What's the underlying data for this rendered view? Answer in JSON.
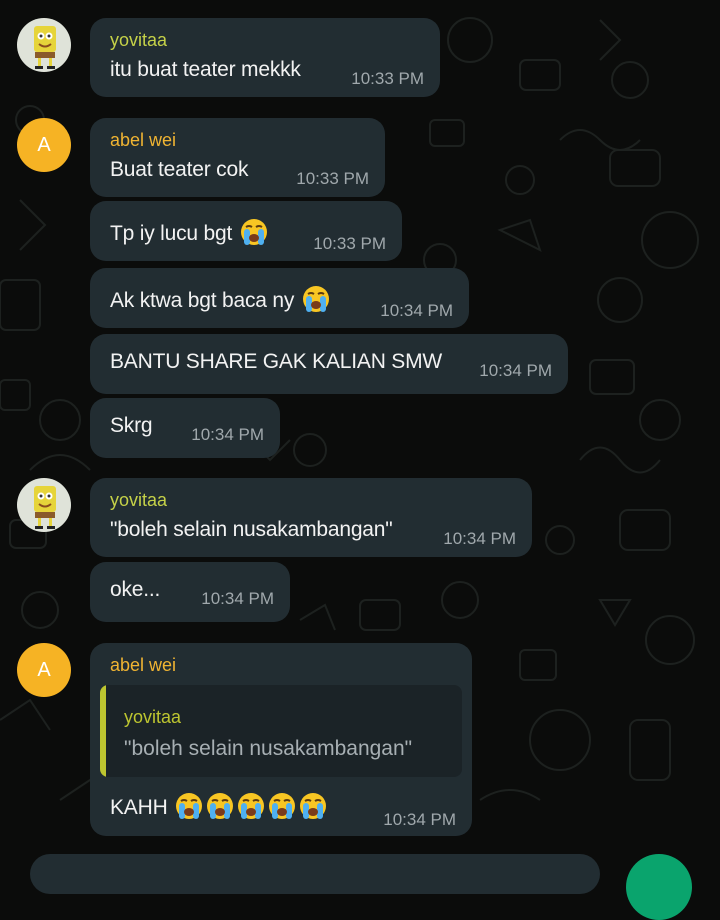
{
  "theme": {
    "bubble_bg": "#222d32",
    "name_yovitaa": "#c5d148",
    "name_abel": "#f0b432",
    "quote_bar": "#bdc530",
    "accent_green": "#0aa46d",
    "avatar_letter_bg": "#f6b324"
  },
  "contacts": {
    "abel_initial": "A",
    "yovitaa_avatar_icon": "sponge-character-icon"
  },
  "messages": [
    {
      "sender": "yovitaa",
      "text": "itu buat teater mekkk",
      "time": "10:33 PM"
    },
    {
      "sender": "abel wei",
      "text": "Buat teater cok",
      "time": "10:33 PM"
    },
    {
      "text": "Tp iy lucu bgt",
      "emoji": "loudly-crying-face",
      "time": "10:33 PM"
    },
    {
      "text": "Ak ktwa bgt baca ny",
      "emoji": "loudly-crying-face",
      "time": "10:34 PM"
    },
    {
      "text": "BANTU SHARE GAK KALIAN SMW",
      "time": "10:34 PM"
    },
    {
      "text": "Skrg",
      "time": "10:34 PM"
    },
    {
      "sender": "yovitaa",
      "text": "\"boleh selain nusakambangan\"",
      "time": "10:34 PM"
    },
    {
      "text": "oke...",
      "time": "10:34 PM"
    },
    {
      "sender": "abel wei",
      "quote": {
        "sender": "yovitaa",
        "text": "\"boleh selain nusakambangan\""
      },
      "text": "KAHH",
      "emoji_count": 5,
      "time": "10:34 PM"
    }
  ]
}
